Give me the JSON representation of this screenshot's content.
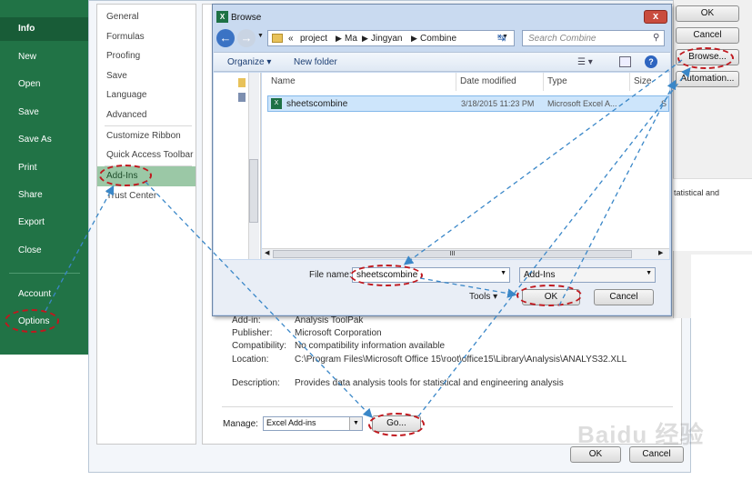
{
  "backstage": {
    "items": [
      "Info",
      "New",
      "Open",
      "Save",
      "Save As",
      "Print",
      "Share",
      "Export",
      "Close"
    ],
    "bottom_items": [
      "Account",
      "Options"
    ]
  },
  "options": {
    "nav": [
      "General",
      "Formulas",
      "Proofing",
      "Save",
      "Language",
      "Advanced",
      "Customize Ribbon",
      "Quick Access Toolbar",
      "Add-Ins",
      "Trust Center"
    ],
    "right_buttons": [
      "OK",
      "Cancel",
      "Browse...",
      "Automation..."
    ],
    "snippet": "tatistical and",
    "details": [
      {
        "label": "Add-in:",
        "value": "Analysis ToolPak"
      },
      {
        "label": "Publisher:",
        "value": "Microsoft Corporation"
      },
      {
        "label": "Compatibility:",
        "value": "No compatibility information available"
      },
      {
        "label": "Location:",
        "value": "C:\\Program Files\\Microsoft Office 15\\root\\office15\\Library\\Analysis\\ANALYS32.XLL"
      },
      {
        "label": "Description:",
        "value": "Provides data analysis tools for statistical and engineering analysis"
      }
    ],
    "manage_label": "Manage:",
    "manage_value": "Excel Add-ins",
    "go_label": "Go...",
    "ok_label": "OK",
    "cancel_label": "Cancel"
  },
  "browse": {
    "title": "Browse",
    "close": "x",
    "path": [
      "«",
      "project",
      "Ma",
      "Jingyan",
      "Combine"
    ],
    "search_placeholder": "Search Combine",
    "organize": "Organize",
    "new_folder": "New folder",
    "columns": [
      "Name",
      "Date modified",
      "Type",
      "Size"
    ],
    "file": {
      "name": "sheetscombine",
      "date": "3/18/2015 11:23 PM",
      "type": "Microsoft Excel A...",
      "size": "S"
    },
    "scroll_mid": "III",
    "filename_label": "File name:",
    "filename_value": "sheetscombine",
    "filter_value": "Add-Ins",
    "tools": "Tools",
    "ok": "OK",
    "cancel": "Cancel"
  },
  "watermark": "Baidu 经验",
  "colors": {
    "excel_green": "#217346",
    "annotation_red": "#c0181e",
    "arrow_blue": "#3a87c8"
  }
}
